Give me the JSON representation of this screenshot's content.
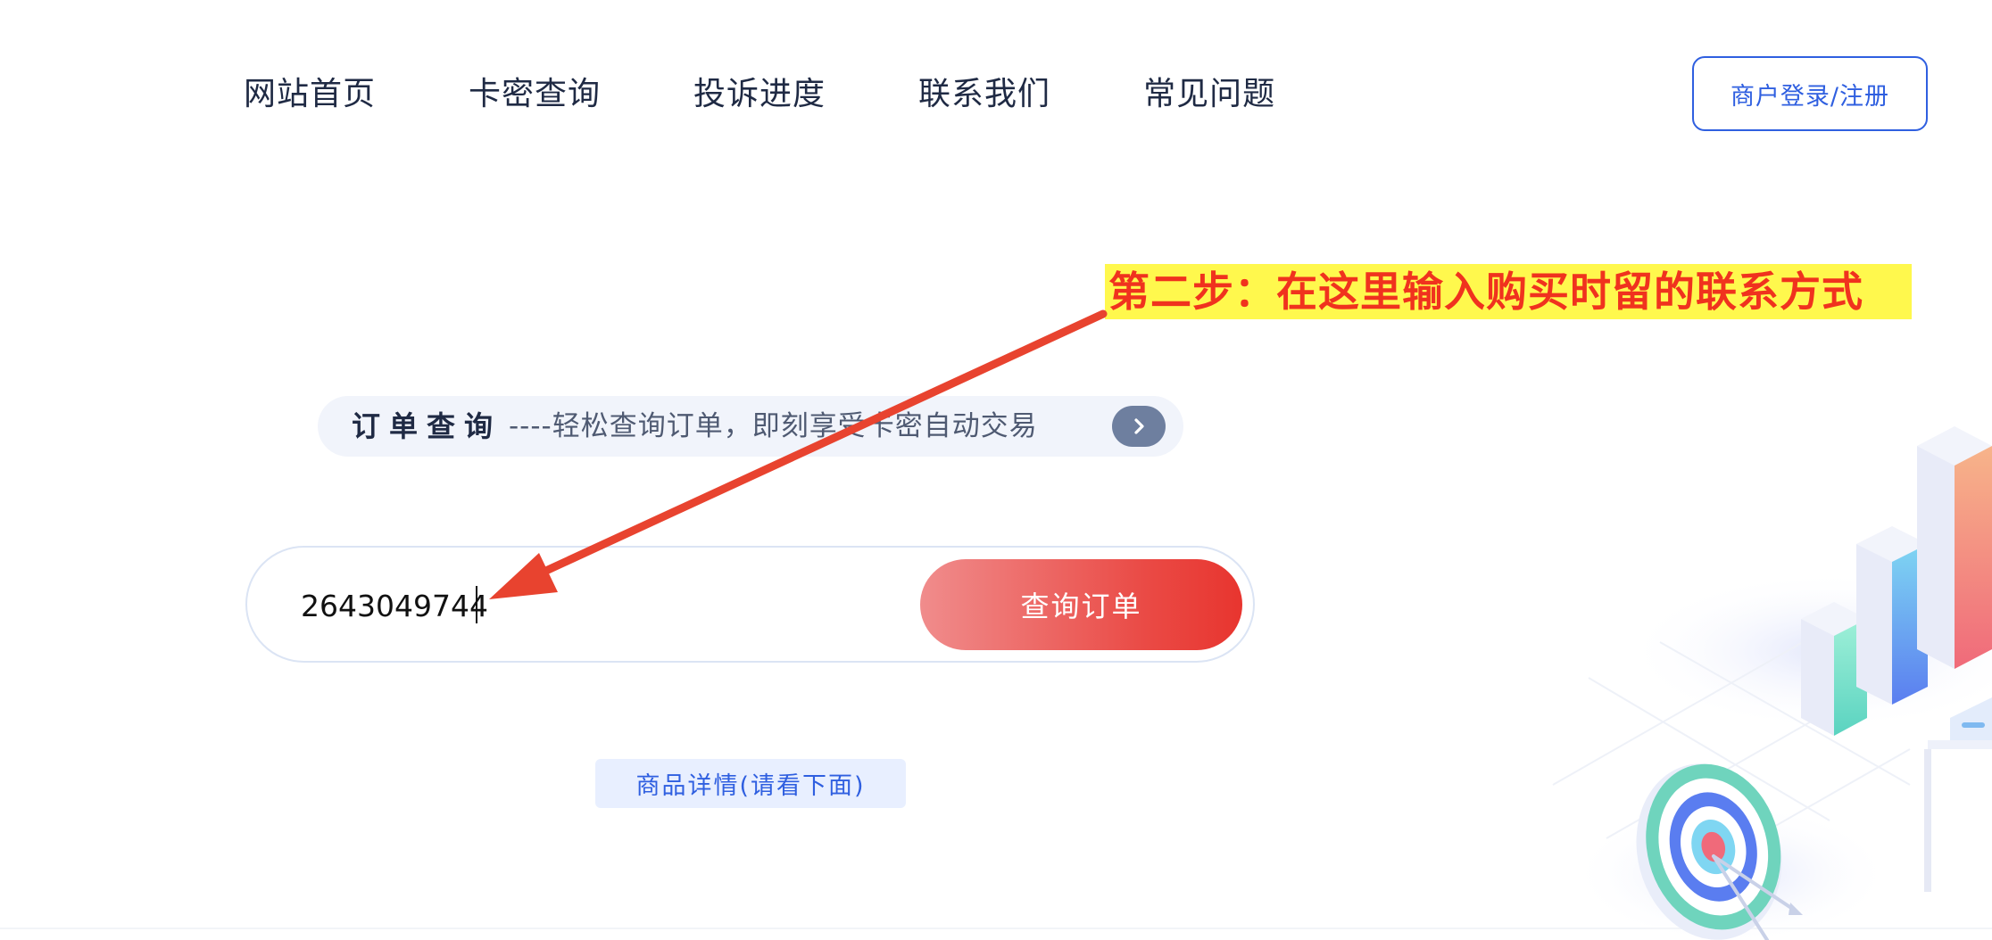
{
  "nav": {
    "items": [
      "网站首页",
      "卡密查询",
      "投诉进度",
      "联系我们",
      "常见问题"
    ],
    "login_label": "商户登录/注册"
  },
  "annotation": {
    "text": "第二步：在这里输入购买时留的联系方式"
  },
  "query_section": {
    "title": "订单查询",
    "subtitle": "----轻松查询订单，即刻享受卡密自动交易",
    "input_value": "2643049744",
    "search_button_label": "查询订单",
    "detail_button_label": "商品详情(请看下面)"
  },
  "colors": {
    "accent_blue": "#2f5fe0",
    "annotation_bg": "#fff84d",
    "annotation_text": "#f0321e",
    "button_red": "#e8352f"
  },
  "icons": {
    "sub_arrow": "chevron-right-icon"
  }
}
